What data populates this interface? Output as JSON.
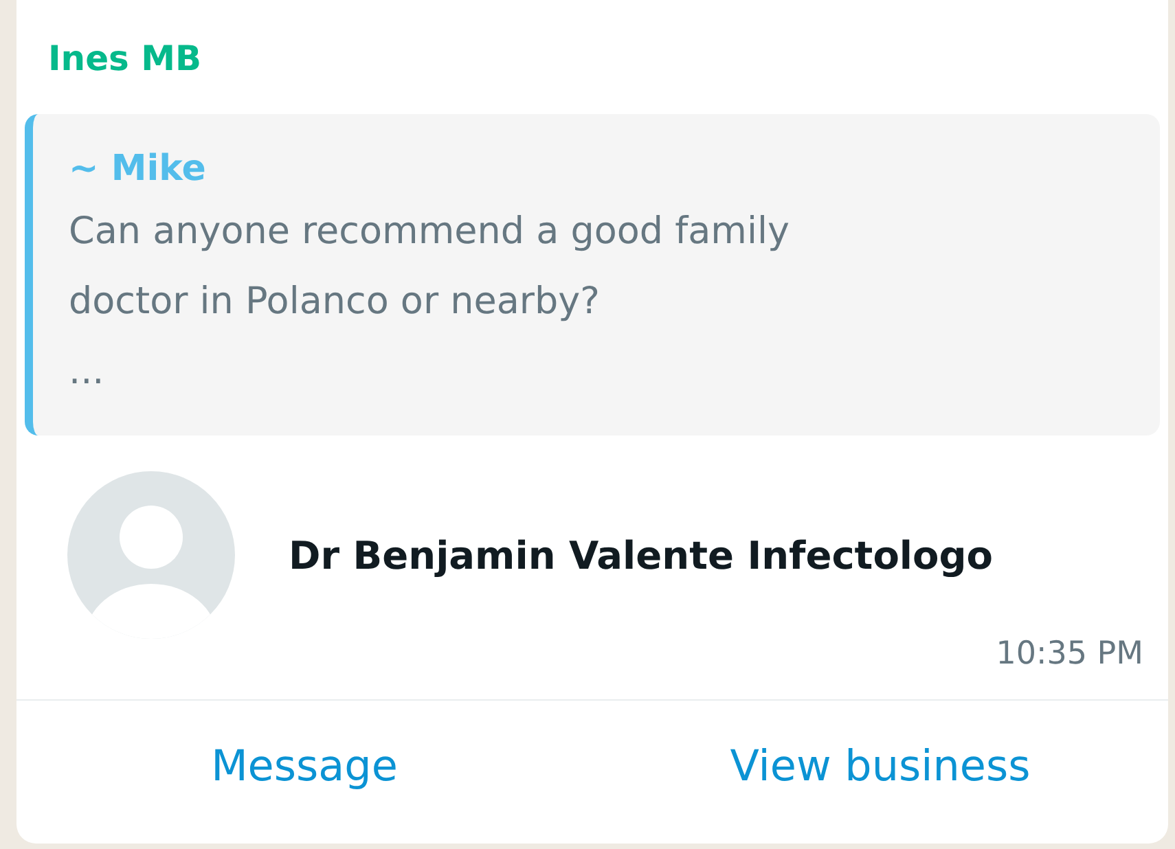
{
  "sender": "Ines MB",
  "quote": {
    "author": "~ Mike",
    "lines": [
      "Can anyone recommend a good family",
      "doctor in Polanco or nearby?",
      "..."
    ]
  },
  "contact": {
    "name": "Dr Benjamin Valente Infectologo"
  },
  "time": "10:35 PM",
  "actions": [
    "Message",
    "View business"
  ]
}
